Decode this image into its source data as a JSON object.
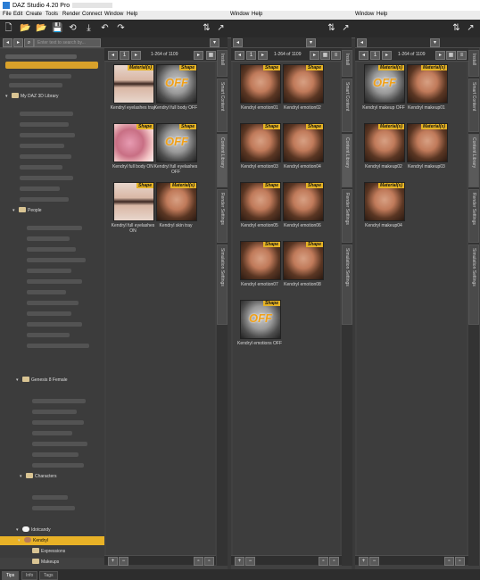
{
  "window": {
    "title": "DAZ Studio 4.20 Pro"
  },
  "menu": {
    "main": [
      "File",
      "Edit",
      "Create",
      "Tools",
      "Render",
      "Connect",
      "Window",
      "Help"
    ],
    "pane2": [
      "Window",
      "Help"
    ],
    "pane3": [
      "Window",
      "Help"
    ]
  },
  "panes": {
    "left": {
      "page_info": "1-264 of 1109"
    },
    "mid": {
      "page_info": "1-264 of 1109"
    },
    "right": {
      "page_info": "1-264 of 1109"
    }
  },
  "sidebar": {
    "search_placeholder": "Enter text to search by...",
    "folders": {
      "library": "My DAZ 3D Library",
      "people": "People",
      "genesis": "Genesis 8 Female",
      "characters": "Characters",
      "vendor": "Idotcandy",
      "product": "Kendryl",
      "expressions": "Expressions",
      "makeups": "Makeups"
    }
  },
  "vertical_tabs": [
    "Install",
    "Smart Content",
    "Content Library",
    "Render Settings",
    "Simulation Settings"
  ],
  "badges": {
    "material": "Material(s)",
    "shape": "Shape",
    "off": "OFF"
  },
  "items_left": [
    {
      "caption": "Kendryl eyelashes tray",
      "badge": "Material(s)",
      "style": "eye"
    },
    {
      "caption": "Kendryl full body OFF",
      "badge": "Shape",
      "style": "gray",
      "off": true
    },
    {
      "caption": "Kendryl full body ON",
      "badge": "Shape",
      "style": "pink"
    },
    {
      "caption": "Kendryl full eyelashes OFF",
      "badge": "Shape",
      "style": "gray",
      "off": true
    },
    {
      "caption": "Kendryl full eyelashes ON",
      "badge": "Shape",
      "style": "eye"
    },
    {
      "caption": "Kendryl skin tray",
      "badge": "Material(s)",
      "style": "face"
    }
  ],
  "items_mid": [
    {
      "caption": "Kendryl emotion01",
      "badge": "Shape"
    },
    {
      "caption": "Kendryl emotion02",
      "badge": "Shape"
    },
    {
      "caption": "Kendryl emotion03",
      "badge": "Shape"
    },
    {
      "caption": "Kendryl emotion04",
      "badge": "Shape"
    },
    {
      "caption": "Kendryl emotion05",
      "badge": "Shape"
    },
    {
      "caption": "Kendryl emotion06",
      "badge": "Shape"
    },
    {
      "caption": "Kendryl emotion07",
      "badge": "Shape"
    },
    {
      "caption": "Kendryl emotion08",
      "badge": "Shape"
    },
    {
      "caption": "Kendryl emotions OFF",
      "badge": "Shape",
      "style": "gray",
      "off": true
    }
  ],
  "items_right": [
    {
      "caption": "Kendryl makeup OFF",
      "badge": "Material(s)",
      "style": "gray",
      "off": true
    },
    {
      "caption": "Kendryl makeup01",
      "badge": "Material(s)"
    },
    {
      "caption": "Kendryl makeup02",
      "badge": "Material(s)"
    },
    {
      "caption": "Kendryl makeup03",
      "badge": "Material(s)"
    },
    {
      "caption": "Kendryl makeup04",
      "badge": "Material(s)"
    }
  ],
  "status_tabs": [
    "Tips",
    "Info",
    "Tags"
  ],
  "colors": {
    "selection": "#e9b227",
    "badge": "#e6b324",
    "off_text": "#f0a018"
  }
}
